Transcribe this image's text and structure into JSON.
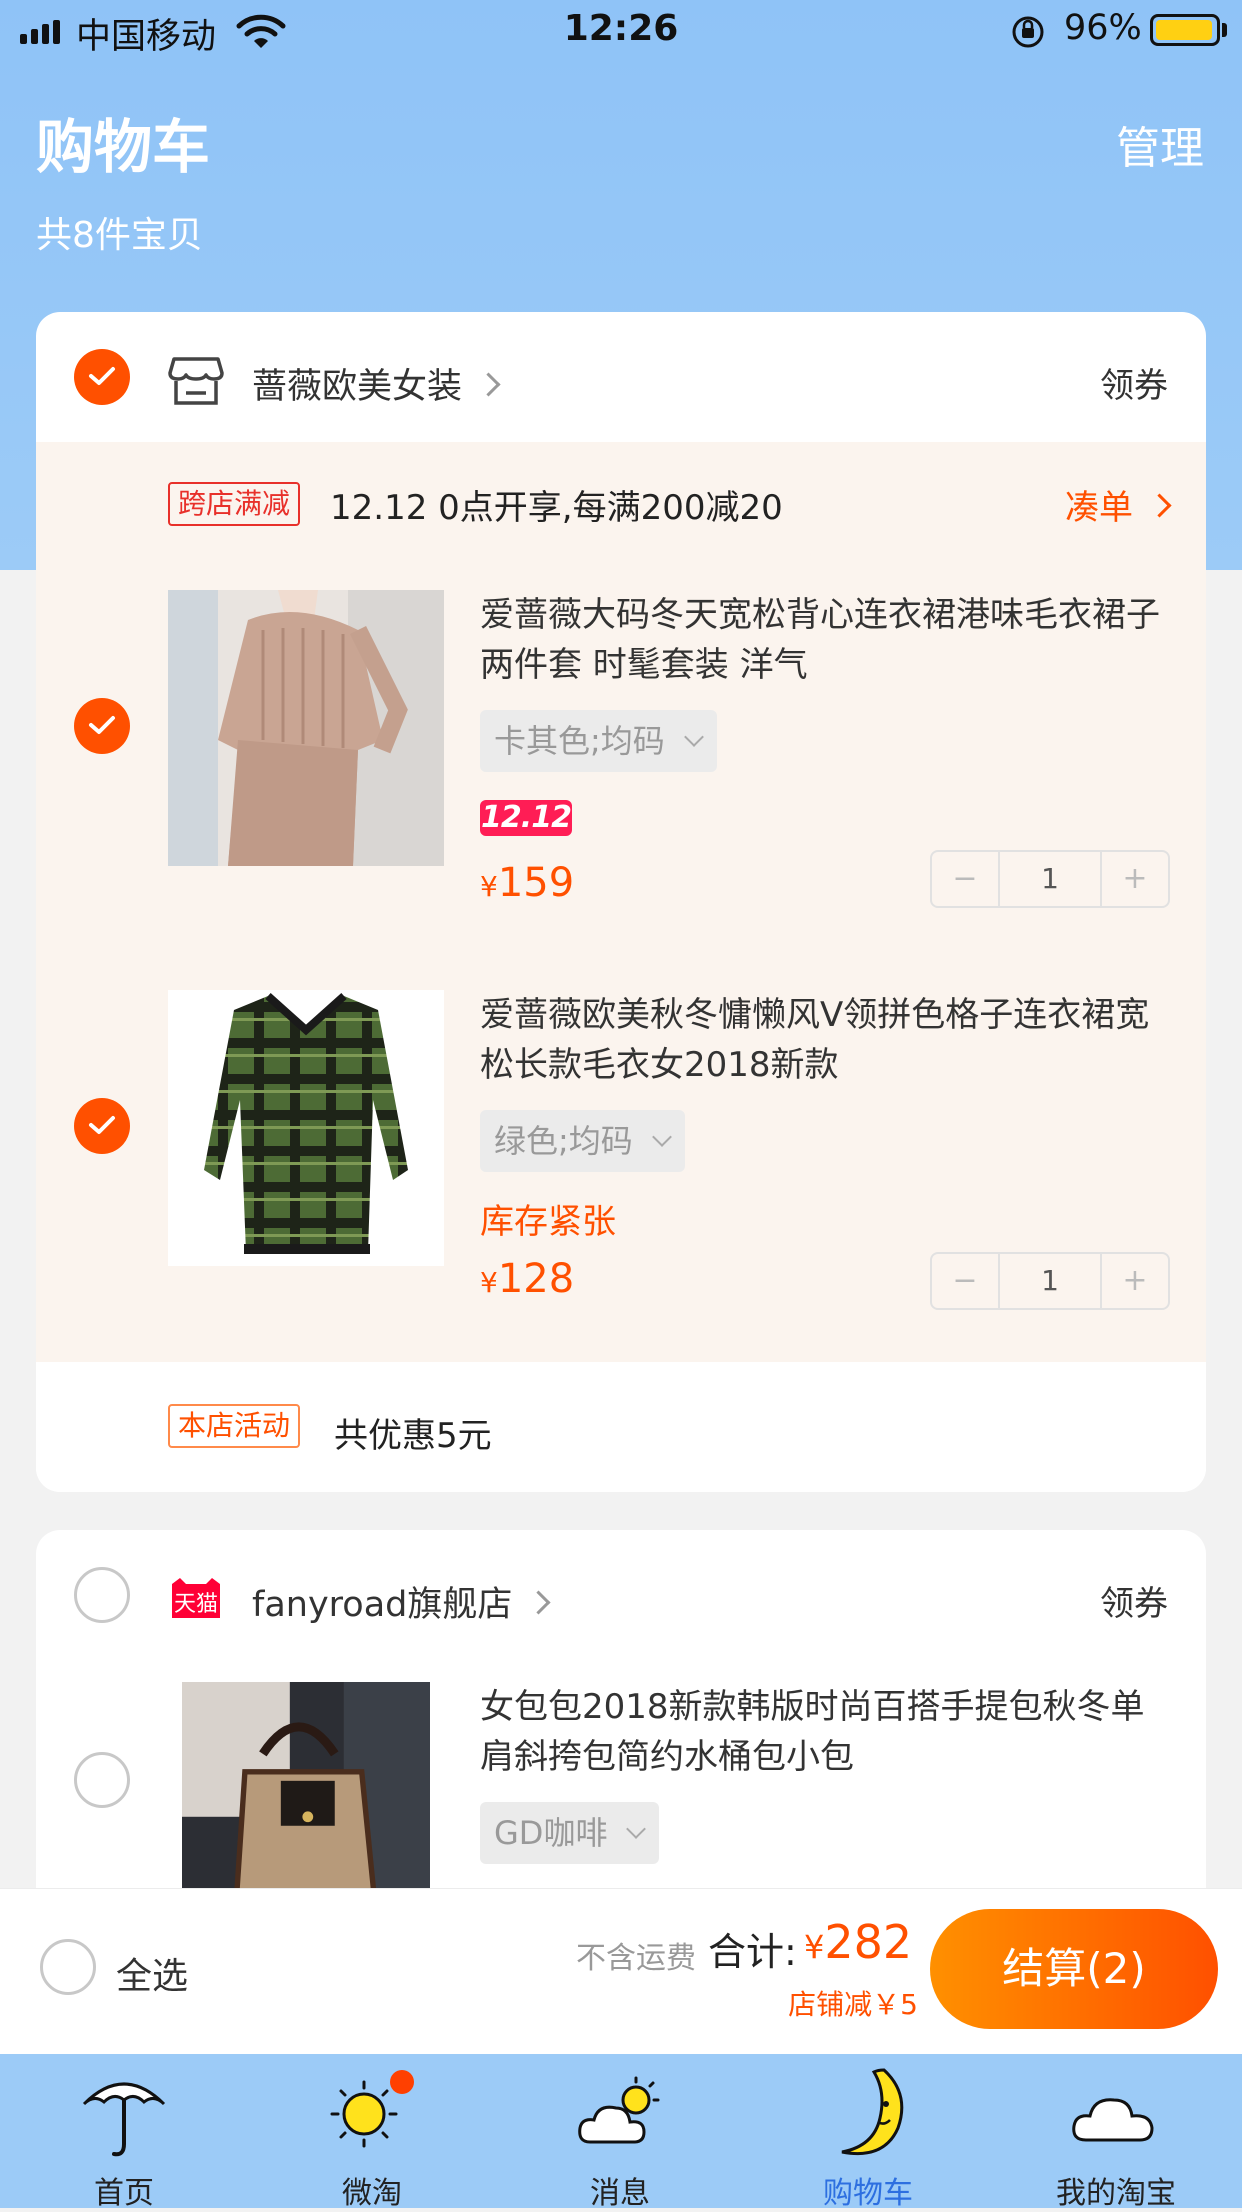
{
  "status_bar": {
    "carrier": "中国移动",
    "time": "12:26",
    "battery": "96%",
    "battery_level": 0.96
  },
  "header": {
    "title": "购物车",
    "manage": "管理",
    "count": "共8件宝贝"
  },
  "shops": [
    {
      "name": "蔷薇欧美女装",
      "coupon": "领券",
      "checked": true,
      "promo": {
        "tag": "跨店满减",
        "text": "12.12 0点开享,每满200减20",
        "action": "凑单"
      },
      "items": [
        {
          "title": "爱蔷薇大码冬天宽松背心连衣裙港味毛衣裙子两件套 时髦套装 洋气",
          "sku": "卡其色;均码",
          "badge": "12.12",
          "currency": "¥",
          "price": "159",
          "qty": "1",
          "checked": true
        },
        {
          "title": "爱蔷薇欧美秋冬慵懒风V领拼色格子连衣裙宽松长款毛衣女2018新款",
          "sku": "绿色;均码",
          "stock_note": "库存紧张",
          "currency": "¥",
          "price": "128",
          "qty": "1",
          "checked": true
        }
      ],
      "shop_promo": {
        "tag": "本店活动",
        "text": "共优惠5元"
      }
    },
    {
      "name": "fanyroad旗舰店",
      "logo_text": "天猫",
      "coupon": "领券",
      "checked": false,
      "items": [
        {
          "title": "女包包2018新款韩版时尚百搭手提包秋冬单肩斜挎包简约水桶包小包",
          "sku": "GD咖啡",
          "checked": false
        }
      ]
    }
  ],
  "checkout": {
    "select_all": "全选",
    "shipping_note": "不含运费",
    "total_label": "合计:",
    "currency": "¥",
    "total": "282",
    "discount": "店铺减￥5",
    "button": "结算(2)"
  },
  "tabs": [
    {
      "label": "首页",
      "icon": "umbrella-icon"
    },
    {
      "label": "微淘",
      "icon": "sun-icon"
    },
    {
      "label": "消息",
      "icon": "cloud-sun-icon"
    },
    {
      "label": "购物车",
      "icon": "moon-icon",
      "active": true
    },
    {
      "label": "我的淘宝",
      "icon": "cloud-icon"
    }
  ],
  "colors": {
    "accent": "#ff5000",
    "header": "#8fc3f7",
    "tabbar": "#9ccbf7"
  }
}
